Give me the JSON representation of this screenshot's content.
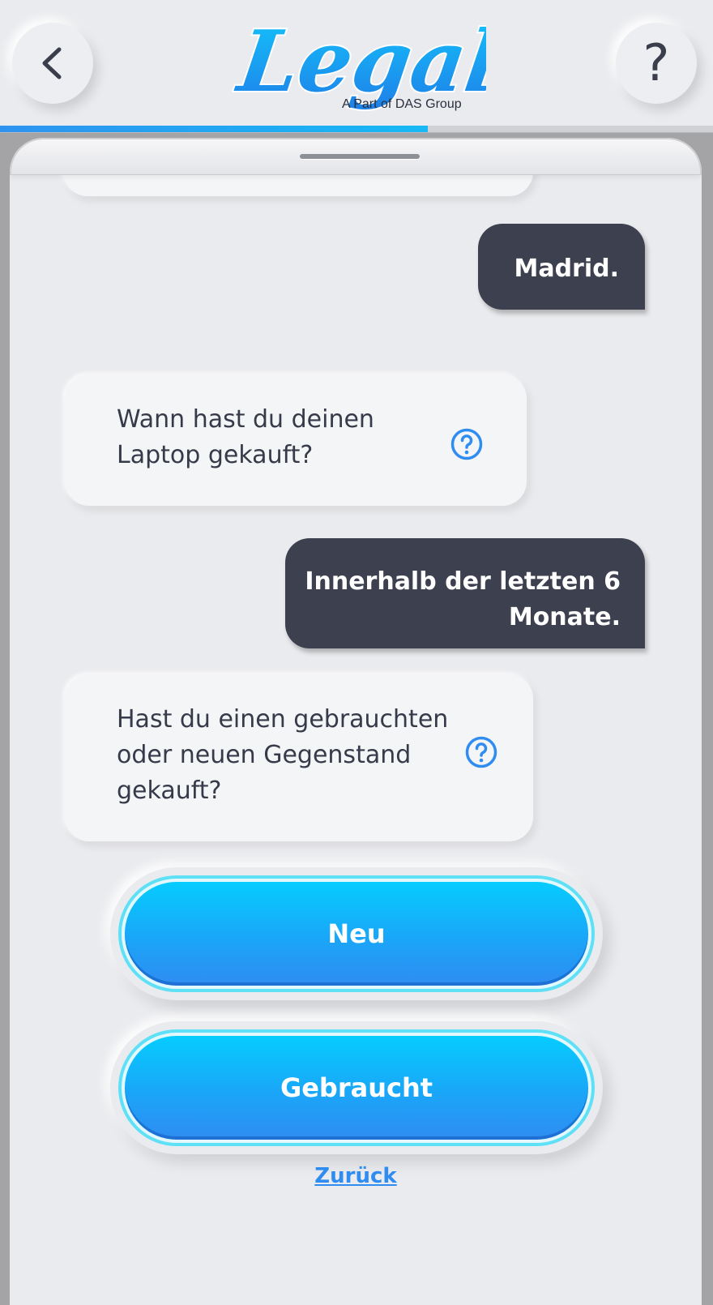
{
  "header": {
    "back_icon": "chevron-left-icon",
    "help_label": "?",
    "logo_text": "Legally",
    "logo_subtitle": "A Part of DAS Group",
    "progress": 0.6
  },
  "colors": {
    "accent": "#1aa6f8",
    "user_bubble": "#3d404e",
    "bot_bubble": "#f4f5f7",
    "link": "#2f8cf1"
  },
  "chat": {
    "messages": [
      {
        "from": "user",
        "text": "Madrid."
      },
      {
        "from": "bot",
        "lines": [
          "Wann hast du deinen",
          "Laptop gekauft?"
        ],
        "help_icon": "question-circle-icon"
      },
      {
        "from": "user",
        "lines": [
          "Innerhalb der letzten 6",
          "Monate."
        ]
      },
      {
        "from": "bot",
        "lines": [
          "Hast du einen gebrauchten",
          "oder neuen Gegenstand",
          "gekauft?"
        ],
        "help_icon": "question-circle-icon"
      }
    ]
  },
  "answers": {
    "options": [
      "Neu",
      "Gebraucht"
    ],
    "back_link": "Zurück"
  }
}
